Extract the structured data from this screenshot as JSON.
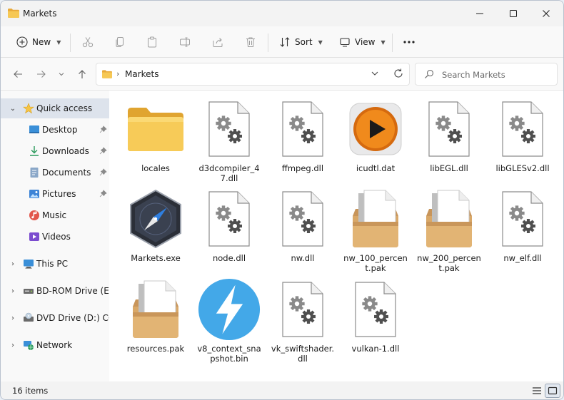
{
  "window": {
    "title": "Markets"
  },
  "toolbar": {
    "new_label": "New",
    "sort_label": "Sort",
    "view_label": "View"
  },
  "address": {
    "crumb": "Markets"
  },
  "search": {
    "placeholder": "Search Markets"
  },
  "sidebar": {
    "quick_access": "Quick access",
    "pinned": [
      "Desktop",
      "Downloads",
      "Documents",
      "Pictures"
    ],
    "unpinned": [
      "Music",
      "Videos"
    ],
    "drives": [
      "This PC",
      "BD-ROM Drive (E:) C",
      "DVD Drive (D:) CCCC",
      "Network"
    ]
  },
  "files": [
    {
      "name": "locales",
      "type": "folder"
    },
    {
      "name": "d3dcompiler_47.dll",
      "type": "dll"
    },
    {
      "name": "ffmpeg.dll",
      "type": "dll"
    },
    {
      "name": "icudtl.dat",
      "type": "media"
    },
    {
      "name": "libEGL.dll",
      "type": "dll"
    },
    {
      "name": "libGLESv2.dll",
      "type": "dll"
    },
    {
      "name": "Markets.exe",
      "type": "exe"
    },
    {
      "name": "node.dll",
      "type": "dll"
    },
    {
      "name": "nw.dll",
      "type": "dll"
    },
    {
      "name": "nw_100_percent.pak",
      "type": "pak"
    },
    {
      "name": "nw_200_percent.pak",
      "type": "pak"
    },
    {
      "name": "nw_elf.dll",
      "type": "dll"
    },
    {
      "name": "resources.pak",
      "type": "pak"
    },
    {
      "name": "v8_context_snapshot.bin",
      "type": "bin"
    },
    {
      "name": "vk_swiftshader.dll",
      "type": "dll"
    },
    {
      "name": "vulkan-1.dll",
      "type": "dll"
    }
  ],
  "status": {
    "count": "16 items"
  },
  "colors": {
    "accent": "#0067c0",
    "folder": "#f3c14b",
    "selection": "#dde3ec"
  }
}
